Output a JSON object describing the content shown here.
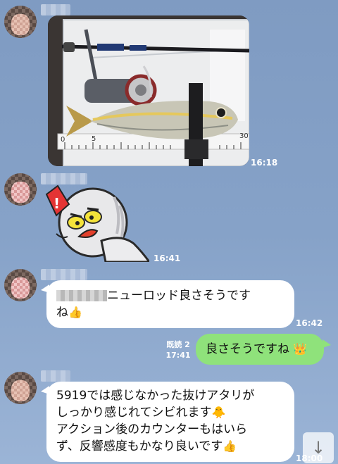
{
  "messages": {
    "m1": {
      "time": "16:18"
    },
    "m2": {
      "time": "16:41"
    },
    "m3": {
      "text_after_name": "ニューロッド良さそうです",
      "line2": "ね",
      "emoji": "👍",
      "time": "16:42"
    },
    "m4": {
      "read_label": "既読 2",
      "time": "17:41",
      "text": "良さそうですね",
      "emoji": "👑"
    },
    "m5": {
      "line1": "5919では感じなかった抜けアタリが",
      "line2": "しっかり感じれてシビれます",
      "line2_emoji": "🐥",
      "line3": "アクション後のカウンターもはいら",
      "line4": "ず、反響感度もかなり良いです",
      "line4_emoji": "👍",
      "time": "18:00"
    }
  },
  "photo": {
    "ruler_labels": [
      "0",
      "5",
      "30"
    ]
  },
  "sticker": {
    "exclaim": "!"
  },
  "scroll_button": {
    "icon": "↓",
    "icon_name": "arrow-down-icon"
  },
  "colors": {
    "background": "#86a2c8",
    "bubble_in": "#ffffff",
    "bubble_out": "#8fe27b",
    "time_text": "#ffffff"
  }
}
